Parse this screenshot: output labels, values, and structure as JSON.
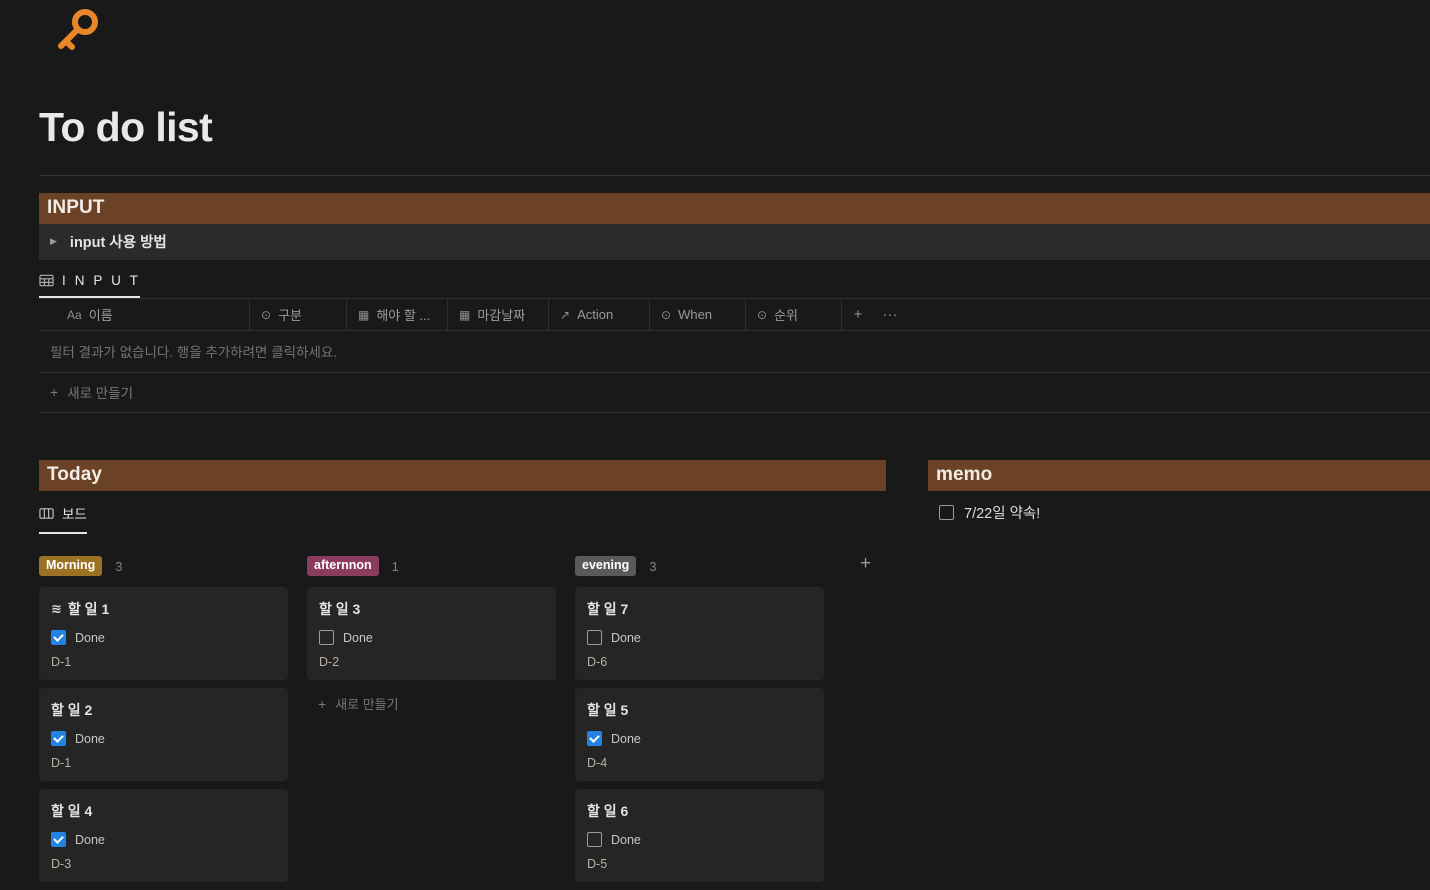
{
  "page": {
    "icon": "key-icon",
    "icon_glyph": "⚷",
    "title": "To do list"
  },
  "input_section": {
    "header": "INPUT",
    "toggle": {
      "arrow_icon": "triangle-right-icon",
      "label": "input 사용 방법"
    },
    "database": {
      "tab_icon": "table-icon",
      "tab_label": "I N P U T",
      "columns": [
        {
          "icon": "text-icon",
          "icon_glyph": "Aa",
          "label": "이름"
        },
        {
          "icon": "select-icon",
          "icon_glyph": "⊙",
          "label": "구분"
        },
        {
          "icon": "date-icon",
          "icon_glyph": "▦",
          "label": "해야 할 ..."
        },
        {
          "icon": "date-icon",
          "icon_glyph": "▦",
          "label": "마감날짜"
        },
        {
          "icon": "relation-icon",
          "icon_glyph": "↗",
          "label": "Action"
        },
        {
          "icon": "select-icon",
          "icon_glyph": "⊙",
          "label": "When"
        },
        {
          "icon": "select-icon",
          "icon_glyph": "⊙",
          "label": "순위"
        }
      ],
      "add_column_label": "+",
      "more_label": "···",
      "empty_message": "필터 결과가 없습니다. 행을 추가하려면 클릭하세요.",
      "new_row_label": "새로 만들기",
      "new_row_plus": "+"
    }
  },
  "today_section": {
    "header": "Today",
    "view_tab": {
      "icon": "board-icon",
      "label": "보드"
    },
    "add_group_label": "+",
    "columns": [
      {
        "badge": "Morning",
        "badge_color": "#9b7223",
        "count": "3",
        "cards": [
          {
            "emoji": "wave-icon",
            "emoji_glyph": "≋",
            "title": "할 일 1",
            "done": true,
            "done_label": "Done",
            "date": "D-1"
          },
          {
            "emoji": "",
            "emoji_glyph": "",
            "title": "할 일 2",
            "done": true,
            "done_label": "Done",
            "date": "D-1"
          },
          {
            "emoji": "",
            "emoji_glyph": "",
            "title": "할 일 4",
            "done": true,
            "done_label": "Done",
            "date": "D-3"
          }
        ],
        "new_label": ""
      },
      {
        "badge": "afternnon",
        "badge_color": "#8a3b5e",
        "count": "1",
        "cards": [
          {
            "emoji": "",
            "emoji_glyph": "",
            "title": "할 일 3",
            "done": false,
            "done_label": "Done",
            "date": "D-2"
          }
        ],
        "new_label": "새로 만들기"
      },
      {
        "badge": "evening",
        "badge_color": "#5a5a5a",
        "count": "3",
        "cards": [
          {
            "emoji": "",
            "emoji_glyph": "",
            "title": "할 일 7",
            "done": false,
            "done_label": "Done",
            "date": "D-6"
          },
          {
            "emoji": "",
            "emoji_glyph": "",
            "title": "할 일 5",
            "done": true,
            "done_label": "Done",
            "date": "D-4"
          },
          {
            "emoji": "",
            "emoji_glyph": "",
            "title": "할 일 6",
            "done": false,
            "done_label": "Done",
            "date": "D-5"
          }
        ],
        "new_label": ""
      }
    ]
  },
  "memo_section": {
    "header": "memo",
    "items": [
      {
        "checked": false,
        "text": "7/22일 약속!"
      }
    ]
  },
  "colors": {
    "page_background": "#191919",
    "section_header": "#6b4226",
    "card_background": "#252525",
    "accent_blue": "#2383e2",
    "icon_orange": "#e8862a"
  }
}
